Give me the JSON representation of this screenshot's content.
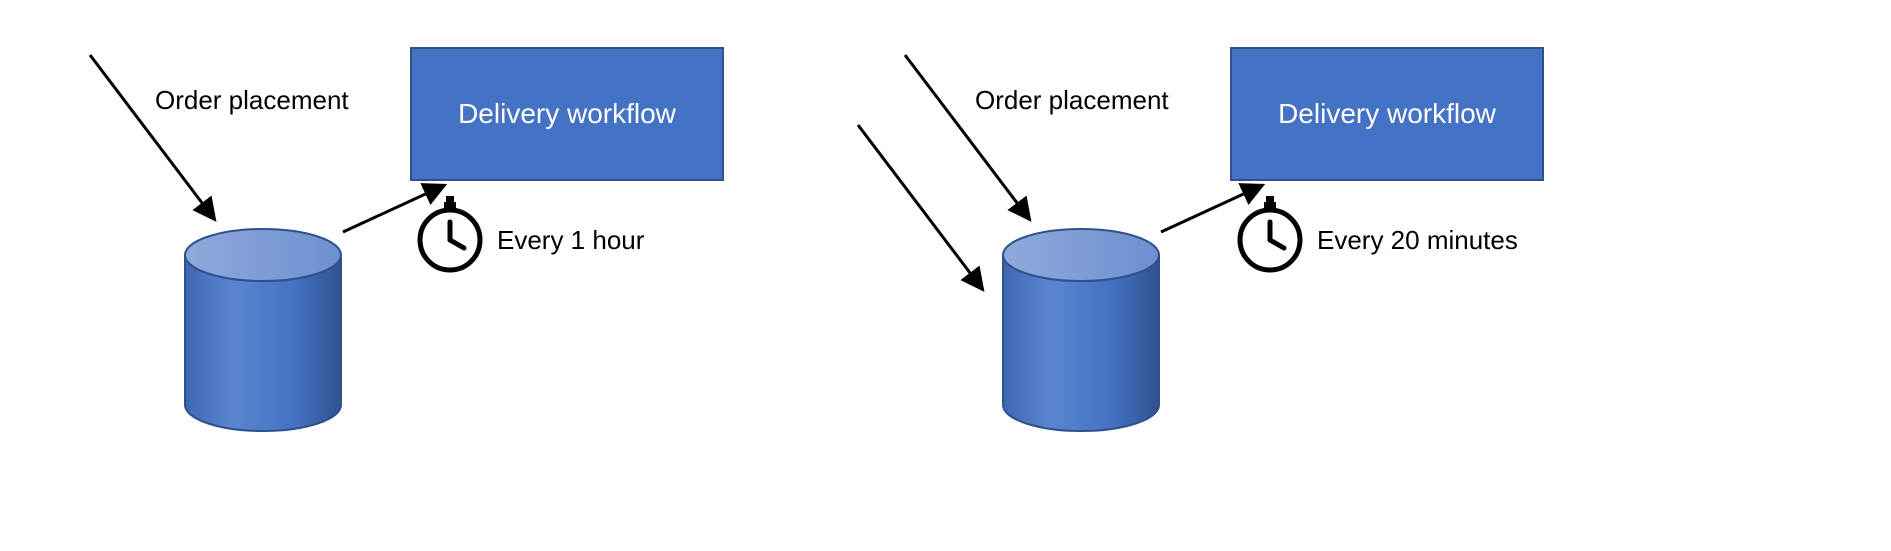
{
  "left": {
    "input_label": "Order placement",
    "box_label": "Delivery workflow",
    "schedule_label": "Every 1 hour"
  },
  "right": {
    "input_label": "Order placement",
    "box_label": "Delivery workflow",
    "schedule_label": "Every 20 minutes"
  },
  "colors": {
    "shape_fill": "#4472C4",
    "shape_stroke": "#2F528F",
    "arrow": "#000000"
  }
}
